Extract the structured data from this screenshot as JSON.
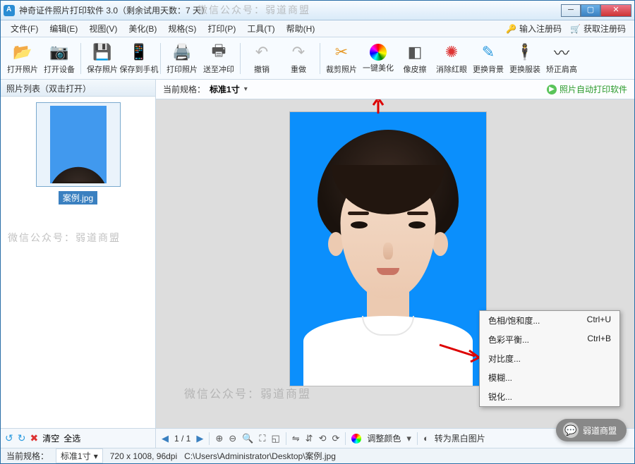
{
  "title": "神奇证件照片打印软件 3.0（剩余试用天数：7 天）",
  "menus": [
    "文件(F)",
    "编辑(E)",
    "视图(V)",
    "美化(B)",
    "规格(S)",
    "打印(P)",
    "工具(T)",
    "帮助(H)"
  ],
  "reg": {
    "key": "输入注册码",
    "buy": "获取注册码"
  },
  "toolbar": {
    "open_photo": "打开照片",
    "open_device": "打开设备",
    "save_photo": "保存照片",
    "save_phone": "保存到手机",
    "print_photo": "打印照片",
    "send_print": "送至冲印",
    "undo": "撤销",
    "redo": "重做",
    "crop": "裁剪照片",
    "beautify": "一键美化",
    "eraser": "像皮擦",
    "redeye": "消除红眼",
    "bg": "更换背景",
    "clothes": "更换服装",
    "shoulder": "矫正肩高"
  },
  "sidebar": {
    "header": "照片列表（双击打开）",
    "thumb_caption": "案例.jpg",
    "rotate": "↻",
    "delete": "✕",
    "clear": "清空",
    "select_all": "全选"
  },
  "main": {
    "spec_label": "当前规格：",
    "spec_value": "标准1寸",
    "auto_print": "照片自动打印软件"
  },
  "watermark": "微信公众号：弱道商盟",
  "context": [
    {
      "label": "色相/饱和度...",
      "shortcut": "Ctrl+U"
    },
    {
      "label": "色彩平衡...",
      "shortcut": "Ctrl+B"
    },
    {
      "label": "对比度...",
      "shortcut": ""
    },
    {
      "label": "模糊...",
      "shortcut": ""
    },
    {
      "label": "锐化...",
      "shortcut": ""
    }
  ],
  "bottom": {
    "page": "1 / 1",
    "adjust_color": "调整颜色",
    "to_gray": "转为黑白图片"
  },
  "status": {
    "spec_label": "当前规格：",
    "spec_value": "标准1寸",
    "dims": "720 x 1008, 96dpi",
    "path": "C:\\Users\\Administrator\\Desktop\\案例.jpg"
  },
  "pill": "弱道商盟"
}
